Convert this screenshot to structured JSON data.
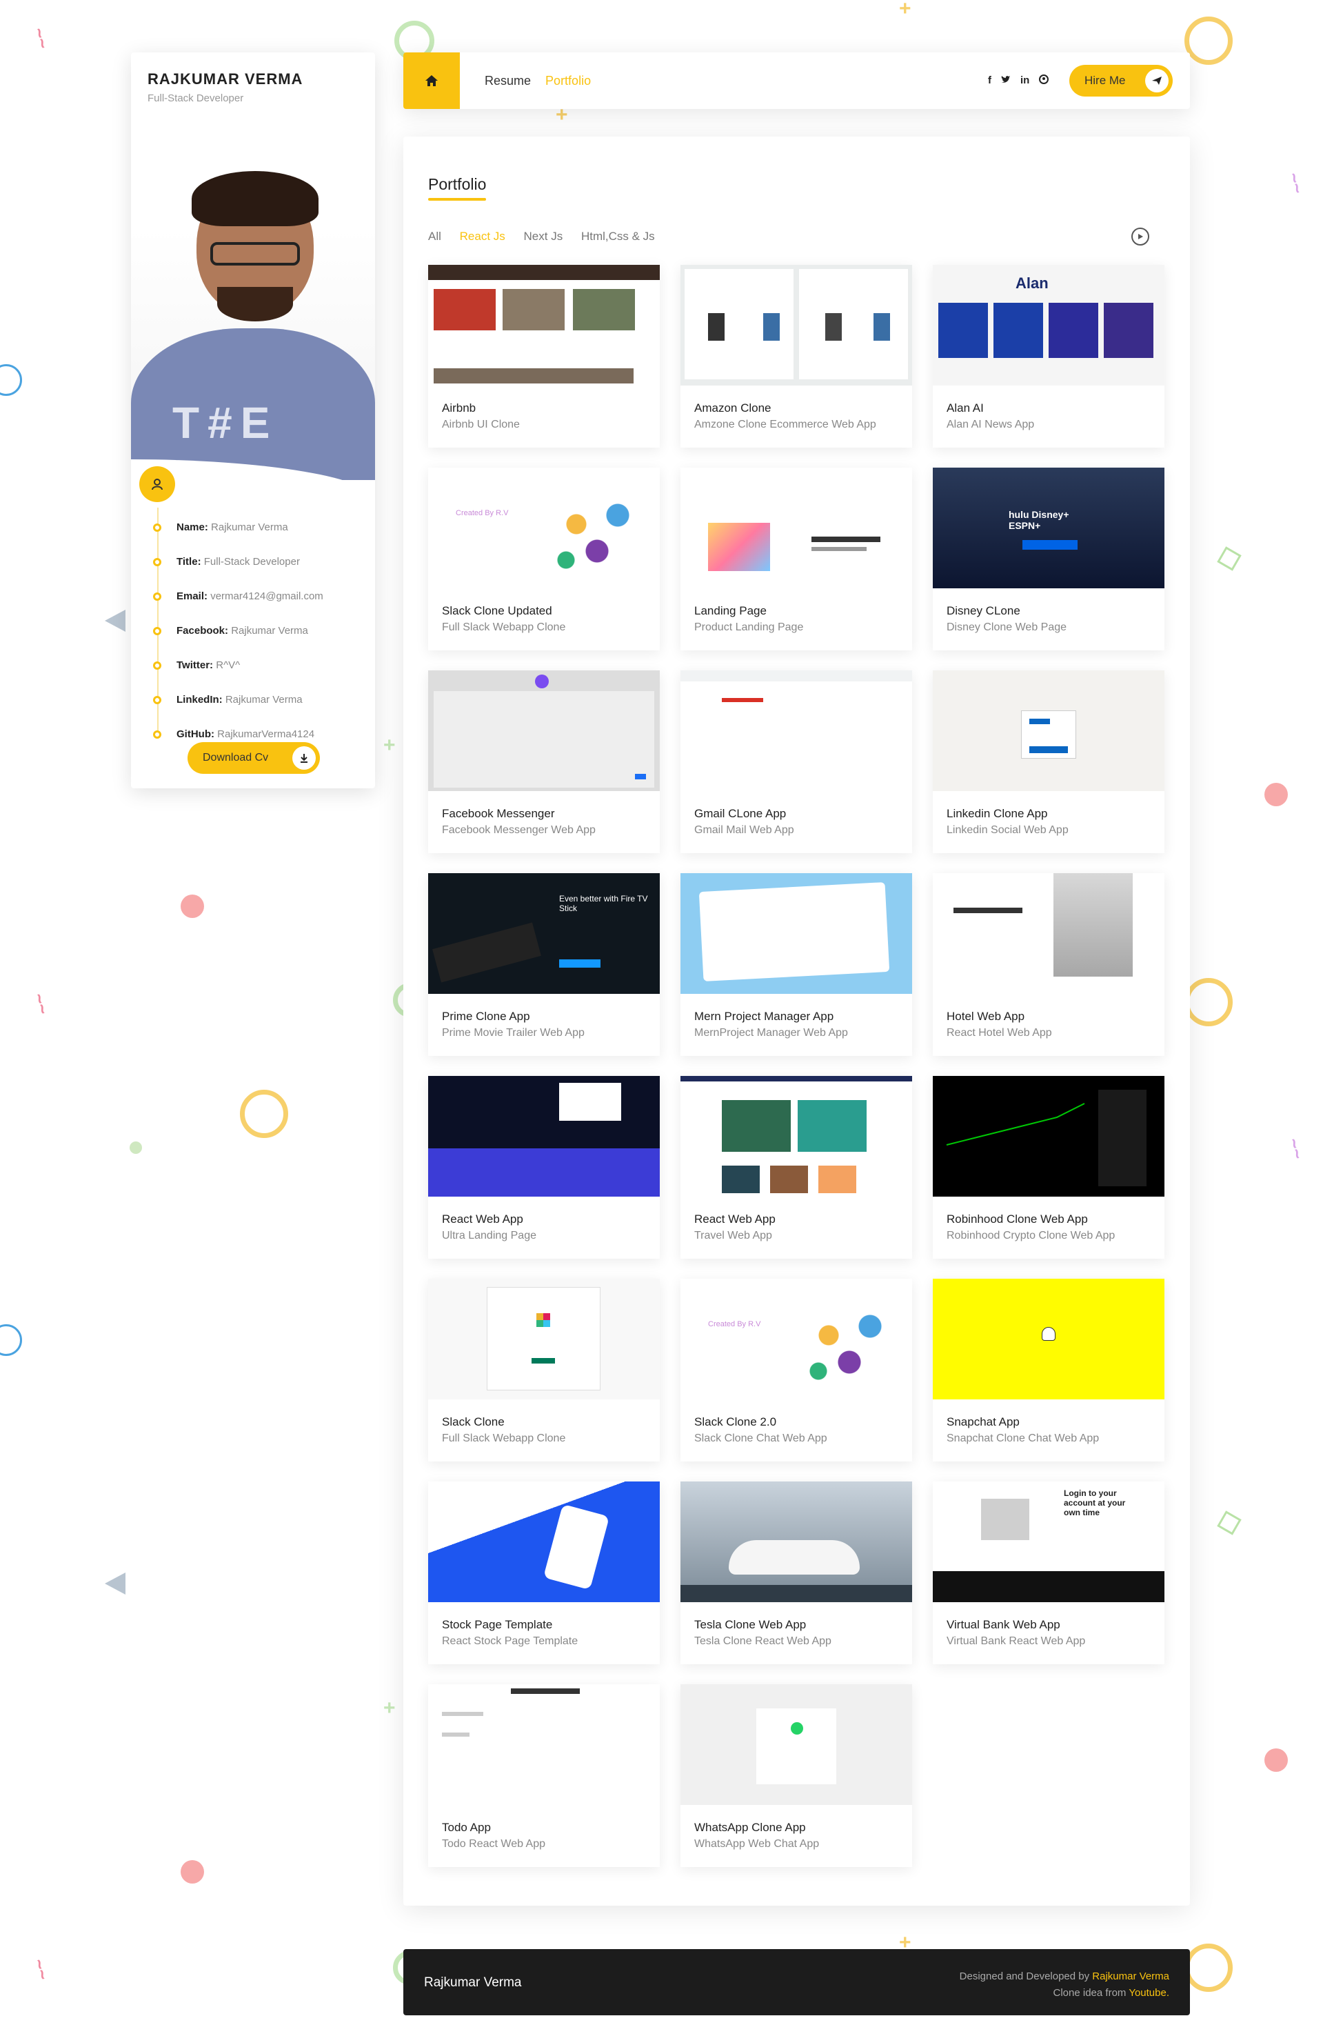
{
  "profile": {
    "name": "RAJKUMAR VERMA",
    "role": "Full-Stack Developer",
    "shirt_text": "T#E",
    "info": [
      {
        "label": "Name:",
        "value": "Rajkumar Verma"
      },
      {
        "label": "Title:",
        "value": "Full-Stack Developer"
      },
      {
        "label": "Email:",
        "value": "vermar4124@gmail.com"
      },
      {
        "label": "Facebook:",
        "value": "Rajkumar Verma"
      },
      {
        "label": "Twitter:",
        "value": "R^V^"
      },
      {
        "label": "LinkedIn:",
        "value": "Rajkumar Verma"
      },
      {
        "label": "GitHub:",
        "value": "RajkumarVerma4124"
      }
    ],
    "download_label": "Download Cv"
  },
  "header": {
    "nav": [
      {
        "label": "Resume",
        "active": false
      },
      {
        "label": "Portfolio",
        "active": true
      }
    ],
    "socials": [
      "f",
      "t",
      "in",
      "gh"
    ],
    "hire_label": "Hire Me"
  },
  "portfolio": {
    "title": "Portfolio",
    "filters": [
      {
        "label": "All",
        "active": false
      },
      {
        "label": "React Js",
        "active": true
      },
      {
        "label": "Next Js",
        "active": false
      },
      {
        "label": "Html,Css & Js",
        "active": false
      }
    ],
    "projects": [
      {
        "title": "Airbnb",
        "subtitle": "Airbnb UI Clone",
        "theme": "airbnb"
      },
      {
        "title": "Amazon Clone",
        "subtitle": "Amzone Clone Ecommerce Web App",
        "theme": "amazon"
      },
      {
        "title": "Alan AI",
        "subtitle": "Alan AI News App",
        "theme": "alan"
      },
      {
        "title": "Slack Clone Updated",
        "subtitle": "Full Slack Webapp Clone",
        "theme": "slack"
      },
      {
        "title": "Landing Page",
        "subtitle": "Product Landing Page",
        "theme": "landing"
      },
      {
        "title": "Disney CLone",
        "subtitle": "Disney Clone Web Page",
        "theme": "disney"
      },
      {
        "title": "Facebook Messenger",
        "subtitle": "Facebook Messenger Web App",
        "theme": "messenger"
      },
      {
        "title": "Gmail CLone App",
        "subtitle": "Gmail Mail Web App",
        "theme": "gmail"
      },
      {
        "title": "Linkedin Clone App",
        "subtitle": "Linkedin Social Web App",
        "theme": "linkedin"
      },
      {
        "title": "Prime Clone App",
        "subtitle": "Prime Movie Trailer Web App",
        "theme": "prime"
      },
      {
        "title": "Mern Project Manager App",
        "subtitle": "MernProject Manager Web App",
        "theme": "mern"
      },
      {
        "title": "Hotel Web App",
        "subtitle": "React Hotel Web App",
        "theme": "hotel"
      },
      {
        "title": "React Web App",
        "subtitle": "Ultra Landing Page",
        "theme": "ultra"
      },
      {
        "title": "React Web App",
        "subtitle": "Travel Web App",
        "theme": "travel"
      },
      {
        "title": "Robinhood Clone Web App",
        "subtitle": "Robinhood Crypto Clone Web App",
        "theme": "robinhood"
      },
      {
        "title": "Slack Clone",
        "subtitle": "Full Slack Webapp Clone",
        "theme": "slack2"
      },
      {
        "title": "Slack Clone 2.0",
        "subtitle": "Slack Clone Chat Web App",
        "theme": "slack"
      },
      {
        "title": "Snapchat App",
        "subtitle": "Snapchat Clone Chat Web App",
        "theme": "snapchat"
      },
      {
        "title": "Stock Page Template",
        "subtitle": "React Stock Page Template",
        "theme": "stock"
      },
      {
        "title": "Tesla Clone Web App",
        "subtitle": "Tesla Clone React Web App",
        "theme": "tesla"
      },
      {
        "title": "Virtual Bank Web App",
        "subtitle": "Virtual Bank React Web App",
        "theme": "bank"
      },
      {
        "title": "Todo App",
        "subtitle": "Todo React Web App",
        "theme": "todo"
      },
      {
        "title": "WhatsApp Clone App",
        "subtitle": "WhatsApp Web Chat App",
        "theme": "whatsapp"
      }
    ]
  },
  "footer": {
    "name": "Rajkumar Verma",
    "designed_prefix": "Designed and Developed by",
    "designed_name": "Rajkumar Verma",
    "clone_prefix": "Clone idea from",
    "clone_source": "Youtube."
  },
  "colors": {
    "accent": "#f9c210",
    "footer_bg": "#1c1c1c"
  }
}
